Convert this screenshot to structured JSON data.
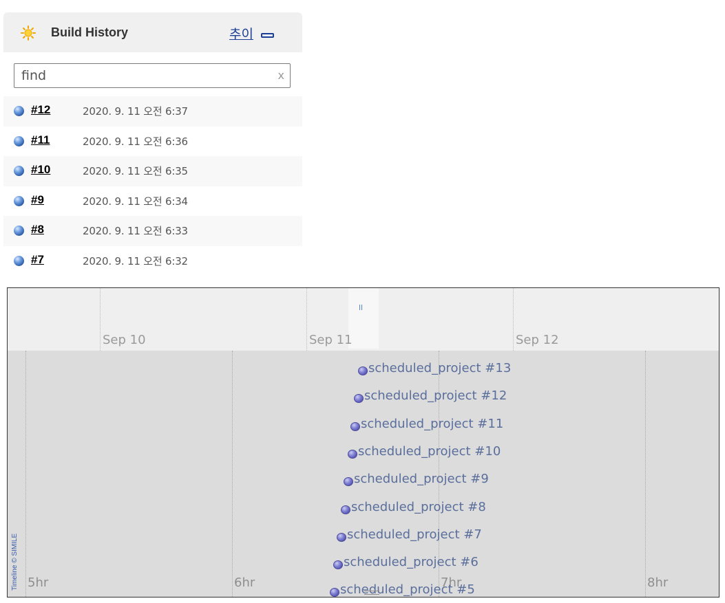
{
  "build_history": {
    "title": "Build History",
    "trend_link": "추이",
    "search": {
      "placeholder": "find",
      "clear_label": "x"
    },
    "builds": [
      {
        "number": "#12",
        "time": "2020. 9. 11 오전 6:37"
      },
      {
        "number": "#11",
        "time": "2020. 9. 11 오전 6:36"
      },
      {
        "number": "#10",
        "time": "2020. 9. 11 오전 6:35"
      },
      {
        "number": "#9",
        "time": "2020. 9. 11 오전 6:34"
      },
      {
        "number": "#8",
        "time": "2020. 9. 11 오전 6:33"
      },
      {
        "number": "#7",
        "time": "2020. 9. 11 오전 6:32"
      }
    ],
    "icons": {
      "header": "sun-icon",
      "status": "blue-ball-icon",
      "collapse": "minus-icon"
    }
  },
  "timeline": {
    "top_band_labels": [
      "Sep 10",
      "Sep 11",
      "Sep 12"
    ],
    "bottom_band_labels": [
      "5hr",
      "6hr",
      "7hr",
      "8hr"
    ],
    "events": [
      "scheduled_project #13",
      "scheduled_project #12",
      "scheduled_project #11",
      "scheduled_project #10",
      "scheduled_project #9",
      "scheduled_project #8",
      "scheduled_project #7",
      "scheduled_project #6",
      "scheduled_project #5"
    ],
    "credit": "Timeline © SIMILE",
    "colors": {
      "band_top": "#efefef",
      "band_bottom": "#dcdcdc",
      "event_text": "#5a6e9c",
      "event_dot": "#8484d6"
    }
  }
}
